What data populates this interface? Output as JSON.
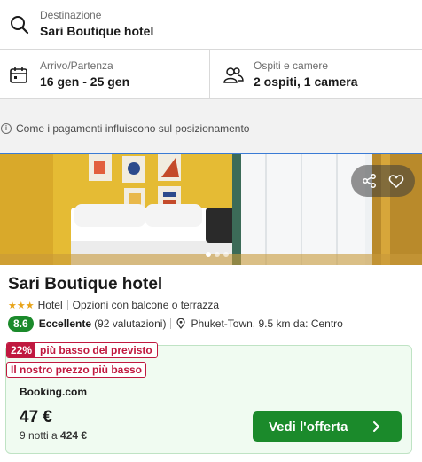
{
  "search": {
    "destination_label": "Destinazione",
    "destination_value": "Sari Boutique hotel",
    "dates_label": "Arrivo/Partenza",
    "dates_value": "16 gen - 25 gen",
    "guests_label": "Ospiti e camere",
    "guests_value": "2 ospiti, 1 camera"
  },
  "info_notice": "Come i pagamenti influiscono sul posizionamento",
  "hotel": {
    "name": "Sari Boutique hotel",
    "stars": 3,
    "type": "Hotel",
    "feature": "Opzioni con balcone o terrazza",
    "score": "8.6",
    "rating_word": "Eccellente",
    "reviews": "(92 valutazioni)",
    "location": "Phuket-Town, 9.5 km da: Centro",
    "photo_count": 3,
    "active_photo": 1
  },
  "offer": {
    "discount_pct": "22%",
    "discount_text": "più basso del previsto",
    "price_tag": "Il nostro prezzo più basso",
    "provider": "Booking.com",
    "price": "47 €",
    "nights_text": "9 notti a",
    "total": "424 €",
    "cta_label": "Vedi l'offerta"
  },
  "colors": {
    "accent_green": "#1b8a2b",
    "deal_red": "#c0183f",
    "star_gold": "#e8a317"
  }
}
